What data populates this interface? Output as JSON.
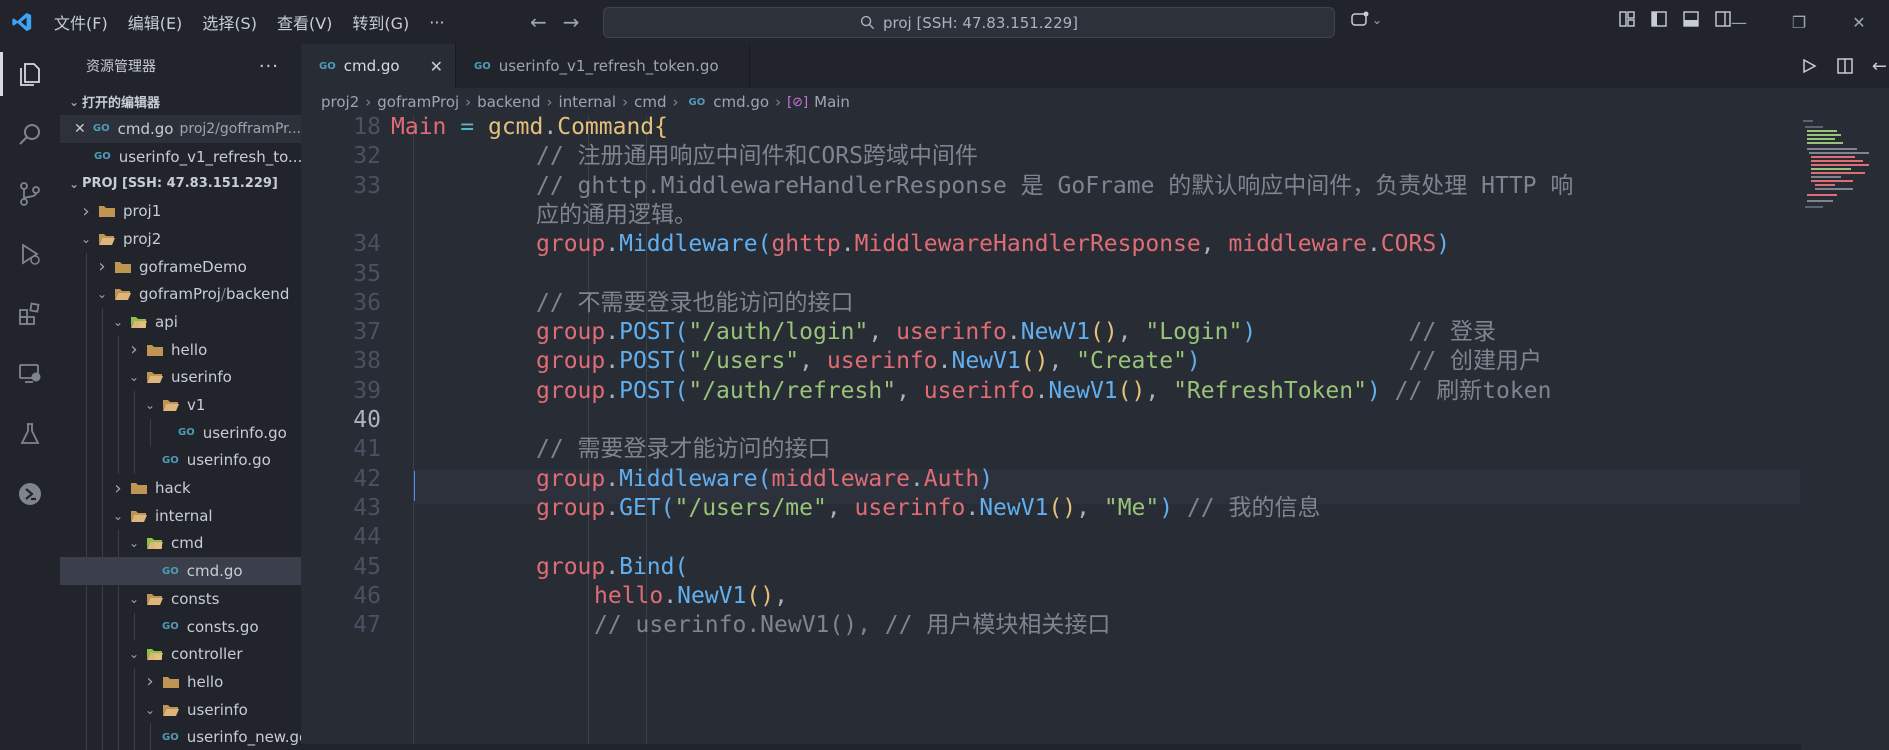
{
  "titlebar": {
    "menus": [
      "文件(F)",
      "编辑(E)",
      "选择(S)",
      "查看(V)",
      "转到(G)",
      "···"
    ],
    "search": "proj [SSH: 47.83.151.229]"
  },
  "sidebar": {
    "title": "资源管理器",
    "open_editors_title": "打开的编辑器",
    "open_editors": [
      {
        "name": "cmd.go",
        "path": "proj2/gofframPr..."
      },
      {
        "name": "userinfo_v1_refresh_to..."
      }
    ],
    "root_title": "PROJ [SSH: 47.83.151.229]",
    "tree": [
      {
        "label": "proj1",
        "type": "folder",
        "depth": 0,
        "open": false
      },
      {
        "label": "proj2",
        "type": "folder",
        "depth": 0,
        "open": true
      },
      {
        "label": "goframeDemo",
        "type": "folder",
        "depth": 1,
        "open": false
      },
      {
        "label": "goframProj",
        "suffix": "backend",
        "type": "folder",
        "depth": 1,
        "open": true
      },
      {
        "label": "api",
        "type": "folder-special",
        "depth": 2,
        "open": true
      },
      {
        "label": "hello",
        "type": "folder",
        "depth": 3,
        "open": false
      },
      {
        "label": "userinfo",
        "type": "folder",
        "depth": 3,
        "open": true
      },
      {
        "label": "v1",
        "type": "folder",
        "depth": 4,
        "open": true
      },
      {
        "label": "userinfo.go",
        "type": "go",
        "depth": 5
      },
      {
        "label": "userinfo.go",
        "type": "go",
        "depth": 4
      },
      {
        "label": "hack",
        "type": "folder",
        "depth": 2,
        "open": false
      },
      {
        "label": "internal",
        "type": "folder",
        "depth": 2,
        "open": true
      },
      {
        "label": "cmd",
        "type": "folder-special",
        "depth": 3,
        "open": true
      },
      {
        "label": "cmd.go",
        "type": "go",
        "depth": 4,
        "active": true
      },
      {
        "label": "consts",
        "type": "folder",
        "depth": 3,
        "open": true
      },
      {
        "label": "consts.go",
        "type": "go",
        "depth": 4
      },
      {
        "label": "controller",
        "type": "folder-special",
        "depth": 3,
        "open": true
      },
      {
        "label": "hello",
        "type": "folder",
        "depth": 4,
        "open": false
      },
      {
        "label": "userinfo",
        "type": "folder",
        "depth": 4,
        "open": true
      },
      {
        "label": "userinfo_new.go",
        "type": "go",
        "depth": 5
      }
    ]
  },
  "tabs": [
    {
      "label": "cmd.go",
      "active": true,
      "close": "✕"
    },
    {
      "label": "userinfo_v1_refresh_token.go",
      "active": false
    }
  ],
  "breadcrumb": [
    "proj2",
    "goframProj",
    "backend",
    "internal",
    "cmd",
    "cmd.go",
    "Main"
  ],
  "editor": {
    "lines": [
      {
        "n": "18",
        "tokens": [
          [
            "t-var",
            "Main"
          ],
          [
            "t-pl",
            " "
          ],
          [
            "t-op",
            "="
          ],
          [
            "t-pl",
            " "
          ],
          [
            "t-type",
            "gcmd"
          ],
          [
            "t-pl",
            "."
          ],
          [
            "t-type",
            "Command"
          ],
          [
            "t-br",
            "{"
          ]
        ]
      },
      {
        "n": "32",
        "indent": 1,
        "tokens": [
          [
            "t-com",
            "// 注册通用响应中间件和CORS跨域中间件"
          ]
        ]
      },
      {
        "n": "33",
        "indent": 1,
        "tokens": [
          [
            "t-com",
            "// ghttp.MiddlewareHandlerResponse 是 GoFrame 的默认响应中间件，负责处理 HTTP 响"
          ]
        ]
      },
      {
        "n": "",
        "indent": 1,
        "tokens": [
          [
            "t-com",
            "应的通用逻辑。"
          ]
        ]
      },
      {
        "n": "34",
        "indent": 1,
        "tokens": [
          [
            "t-var",
            "group"
          ],
          [
            "t-pl",
            "."
          ],
          [
            "t-fn",
            "Middleware"
          ],
          [
            "t-br3",
            "("
          ],
          [
            "t-var",
            "ghttp"
          ],
          [
            "t-pl",
            "."
          ],
          [
            "t-var",
            "MiddlewareHandlerResponse"
          ],
          [
            "t-pl",
            ", "
          ],
          [
            "t-var",
            "middleware"
          ],
          [
            "t-pl",
            "."
          ],
          [
            "t-var",
            "CORS"
          ],
          [
            "t-br3",
            ")"
          ]
        ]
      },
      {
        "n": "35",
        "indent": 1,
        "tokens": []
      },
      {
        "n": "36",
        "indent": 1,
        "tokens": [
          [
            "t-com",
            "// 不需要登录也能访问的接口"
          ]
        ]
      },
      {
        "n": "37",
        "indent": 1,
        "tokens": [
          [
            "t-var",
            "group"
          ],
          [
            "t-pl",
            "."
          ],
          [
            "t-fn",
            "POST"
          ],
          [
            "t-br3",
            "("
          ],
          [
            "t-str",
            "\"/auth/login\""
          ],
          [
            "t-pl",
            ", "
          ],
          [
            "t-var",
            "userinfo"
          ],
          [
            "t-pl",
            "."
          ],
          [
            "t-fn",
            "NewV1"
          ],
          [
            "t-br",
            "()"
          ],
          [
            "t-pl",
            ", "
          ],
          [
            "t-str",
            "\"Login\""
          ],
          [
            "t-br3",
            ")"
          ],
          [
            "t-pl",
            "           "
          ],
          [
            "t-com",
            "// 登录"
          ]
        ]
      },
      {
        "n": "38",
        "indent": 1,
        "tokens": [
          [
            "t-var",
            "group"
          ],
          [
            "t-pl",
            "."
          ],
          [
            "t-fn",
            "POST"
          ],
          [
            "t-br3",
            "("
          ],
          [
            "t-str",
            "\"/users\""
          ],
          [
            "t-pl",
            ", "
          ],
          [
            "t-var",
            "userinfo"
          ],
          [
            "t-pl",
            "."
          ],
          [
            "t-fn",
            "NewV1"
          ],
          [
            "t-br",
            "()"
          ],
          [
            "t-pl",
            ", "
          ],
          [
            "t-str",
            "\"Create\""
          ],
          [
            "t-br3",
            ")"
          ],
          [
            "t-pl",
            "               "
          ],
          [
            "t-com",
            "// 创建用户"
          ]
        ]
      },
      {
        "n": "39",
        "indent": 1,
        "tokens": [
          [
            "t-var",
            "group"
          ],
          [
            "t-pl",
            "."
          ],
          [
            "t-fn",
            "POST"
          ],
          [
            "t-br3",
            "("
          ],
          [
            "t-str",
            "\"/auth/refresh\""
          ],
          [
            "t-pl",
            ", "
          ],
          [
            "t-var",
            "userinfo"
          ],
          [
            "t-pl",
            "."
          ],
          [
            "t-fn",
            "NewV1"
          ],
          [
            "t-br",
            "()"
          ],
          [
            "t-pl",
            ", "
          ],
          [
            "t-str",
            "\"RefreshToken\""
          ],
          [
            "t-br3",
            ")"
          ],
          [
            "t-pl",
            " "
          ],
          [
            "t-com",
            "// 刷新token"
          ]
        ]
      },
      {
        "n": "40",
        "indent": 1,
        "current": true,
        "tokens": []
      },
      {
        "n": "41",
        "indent": 1,
        "tokens": [
          [
            "t-com",
            "// 需要登录才能访问的接口"
          ]
        ]
      },
      {
        "n": "42",
        "indent": 1,
        "tokens": [
          [
            "t-var",
            "group"
          ],
          [
            "t-pl",
            "."
          ],
          [
            "t-fn",
            "Middleware"
          ],
          [
            "t-br3",
            "("
          ],
          [
            "t-var",
            "middleware"
          ],
          [
            "t-pl",
            "."
          ],
          [
            "t-var",
            "Auth"
          ],
          [
            "t-br3",
            ")"
          ]
        ]
      },
      {
        "n": "43",
        "indent": 1,
        "tokens": [
          [
            "t-var",
            "group"
          ],
          [
            "t-pl",
            "."
          ],
          [
            "t-fn",
            "GET"
          ],
          [
            "t-br3",
            "("
          ],
          [
            "t-str",
            "\"/users/me\""
          ],
          [
            "t-pl",
            ", "
          ],
          [
            "t-var",
            "userinfo"
          ],
          [
            "t-pl",
            "."
          ],
          [
            "t-fn",
            "NewV1"
          ],
          [
            "t-br",
            "()"
          ],
          [
            "t-pl",
            ", "
          ],
          [
            "t-str",
            "\"Me\""
          ],
          [
            "t-br3",
            ")"
          ],
          [
            "t-pl",
            " "
          ],
          [
            "t-com",
            "// 我的信息"
          ]
        ]
      },
      {
        "n": "44",
        "indent": 1,
        "tokens": []
      },
      {
        "n": "45",
        "indent": 1,
        "tokens": [
          [
            "t-var",
            "group"
          ],
          [
            "t-pl",
            "."
          ],
          [
            "t-fn",
            "Bind"
          ],
          [
            "t-br3",
            "("
          ]
        ]
      },
      {
        "n": "46",
        "indent": 2,
        "tokens": [
          [
            "t-var",
            "hello"
          ],
          [
            "t-pl",
            "."
          ],
          [
            "t-fn",
            "NewV1"
          ],
          [
            "t-br",
            "()"
          ],
          [
            "t-pl",
            ","
          ]
        ]
      },
      {
        "n": "47",
        "indent": 2,
        "tokens": [
          [
            "t-com",
            "// userinfo.NewV1(), // 用户模块相关接口"
          ]
        ]
      }
    ]
  },
  "colors": {
    "accent": "#528bff",
    "folder": "#c09553",
    "go": "#519aba"
  }
}
